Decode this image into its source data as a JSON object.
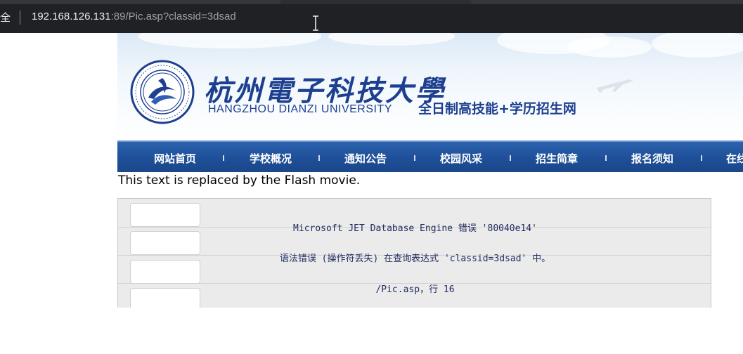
{
  "browser": {
    "security_label": "全",
    "url_host": "192.168.126.131",
    "url_rest": ":89/Pic.asp?classid=3dsad"
  },
  "header": {
    "university_cn": "杭州電子科技大學",
    "university_en": "HANGZHOU DIANZI UNIVERSITY",
    "site_name": "全日制高技能+学历招生网",
    "logo_ring_text": "杭州电子科技大学 · HANGZHOU DIANZI UNIVERSITY"
  },
  "nav": {
    "items": [
      "网站首页",
      "学校概况",
      "通知公告",
      "校园风采",
      "招生简章",
      "报名须知",
      "在线"
    ]
  },
  "flash_placeholder": "This text is replaced by the Flash movie.",
  "error": {
    "line1": "Microsoft JET Database Engine 错误 '80040e14'",
    "line2": "语法错误 (操作符丢失) 在查询表达式 'classid=3dsad' 中。",
    "line3": "/Pic.asp，行 16"
  },
  "colors": {
    "nav_bg": "#1f4f98",
    "brand_blue": "#1d3f8f",
    "error_text": "#1f2b5e"
  }
}
